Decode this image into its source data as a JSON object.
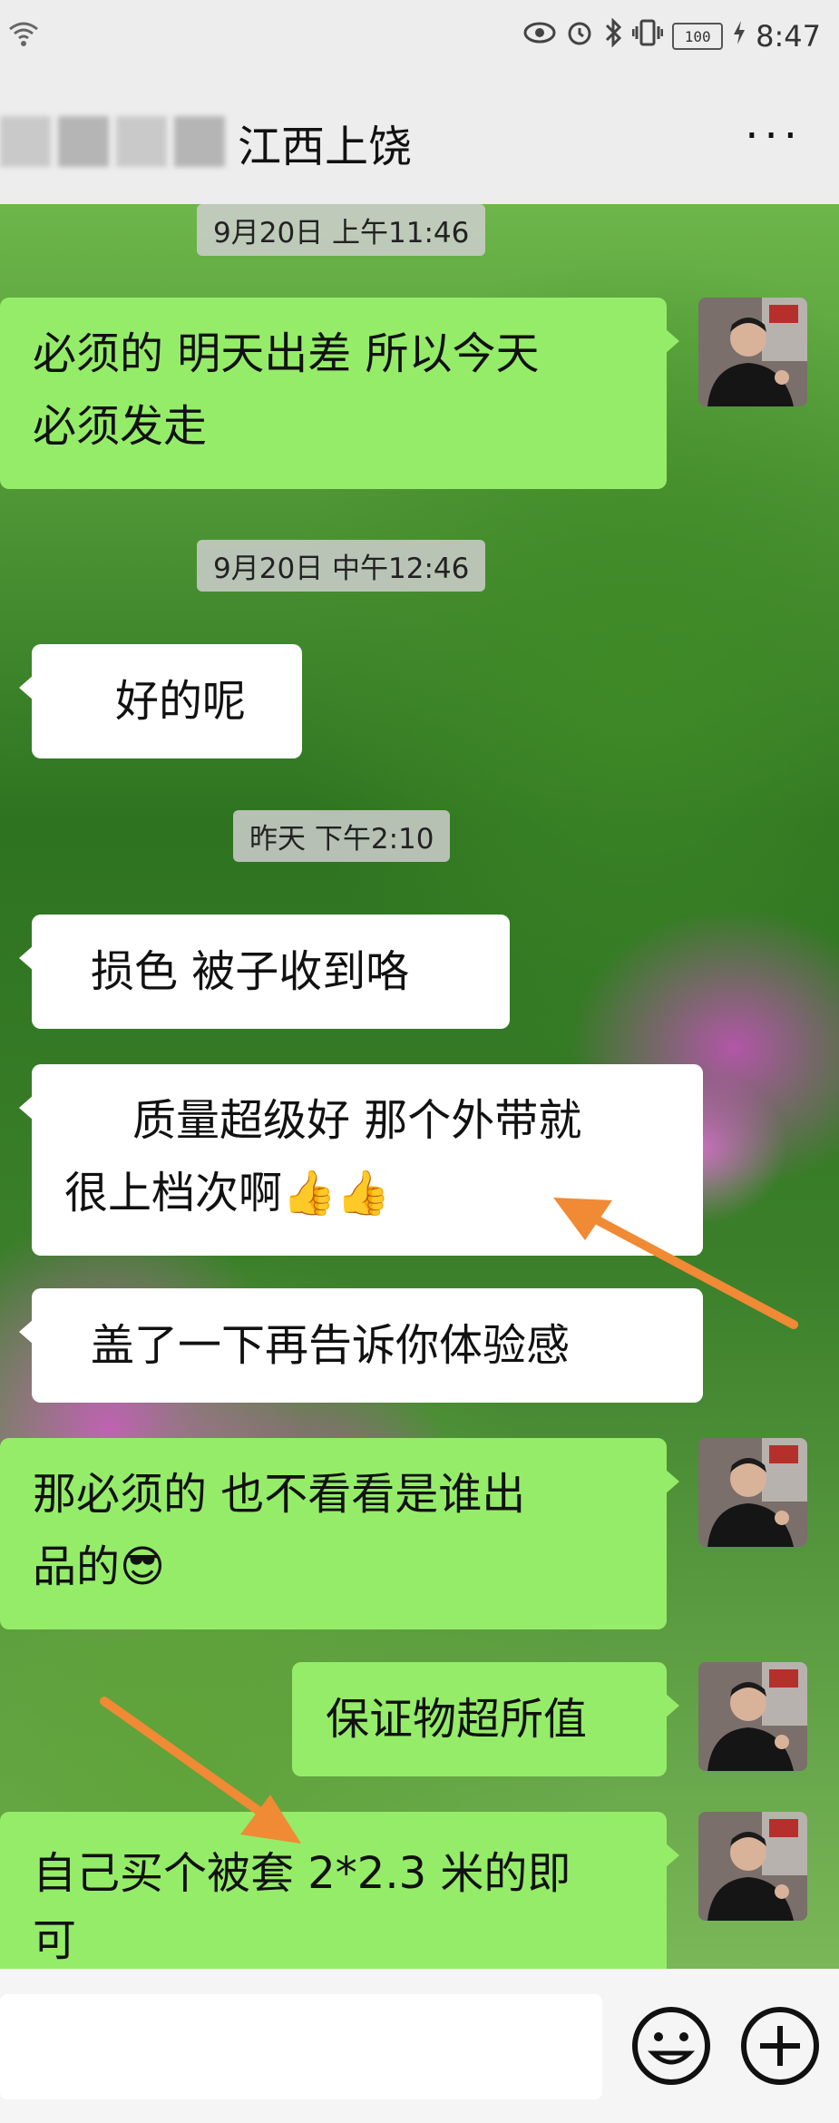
{
  "status_bar": {
    "time": "8:47",
    "battery": "100"
  },
  "header": {
    "title": "江西上饶",
    "more_label": "···"
  },
  "messages": [
    {
      "kind": "timestamp",
      "text": "9月20日 上午11:46"
    },
    {
      "kind": "sent",
      "lines": [
        "必须的 明天出差 所以今天",
        "必须发走"
      ]
    },
    {
      "kind": "timestamp",
      "text": "9月20日 中午12:46"
    },
    {
      "kind": "received",
      "lines": [
        "好的呢"
      ]
    },
    {
      "kind": "timestamp",
      "text": "昨天 下午2:10"
    },
    {
      "kind": "received",
      "lines": [
        "损色 被子收到咯"
      ]
    },
    {
      "kind": "received",
      "lines": [
        "质量超级好 那个外带就",
        "很上档次啊👍👍"
      ]
    },
    {
      "kind": "received",
      "lines": [
        "盖了一下再告诉你体验感"
      ]
    },
    {
      "kind": "sent",
      "lines": [
        "那必须的 也不看看是谁出",
        "品的😎"
      ]
    },
    {
      "kind": "sent",
      "lines": [
        "保证物超所值"
      ]
    },
    {
      "kind": "sent",
      "lines": [
        "自己买个被套 2*2.3 米的即",
        "可"
      ]
    }
  ],
  "colors": {
    "sent_bubble": "#95ec69",
    "received_bubble": "#ffffff",
    "arrow": "#f08a34"
  },
  "icons": [
    "wifi-icon",
    "eye-icon",
    "alarm-icon",
    "bluetooth-icon",
    "vibrate-icon",
    "battery-icon",
    "charging-icon",
    "more-icon",
    "emoji-icon",
    "plus-icon"
  ]
}
